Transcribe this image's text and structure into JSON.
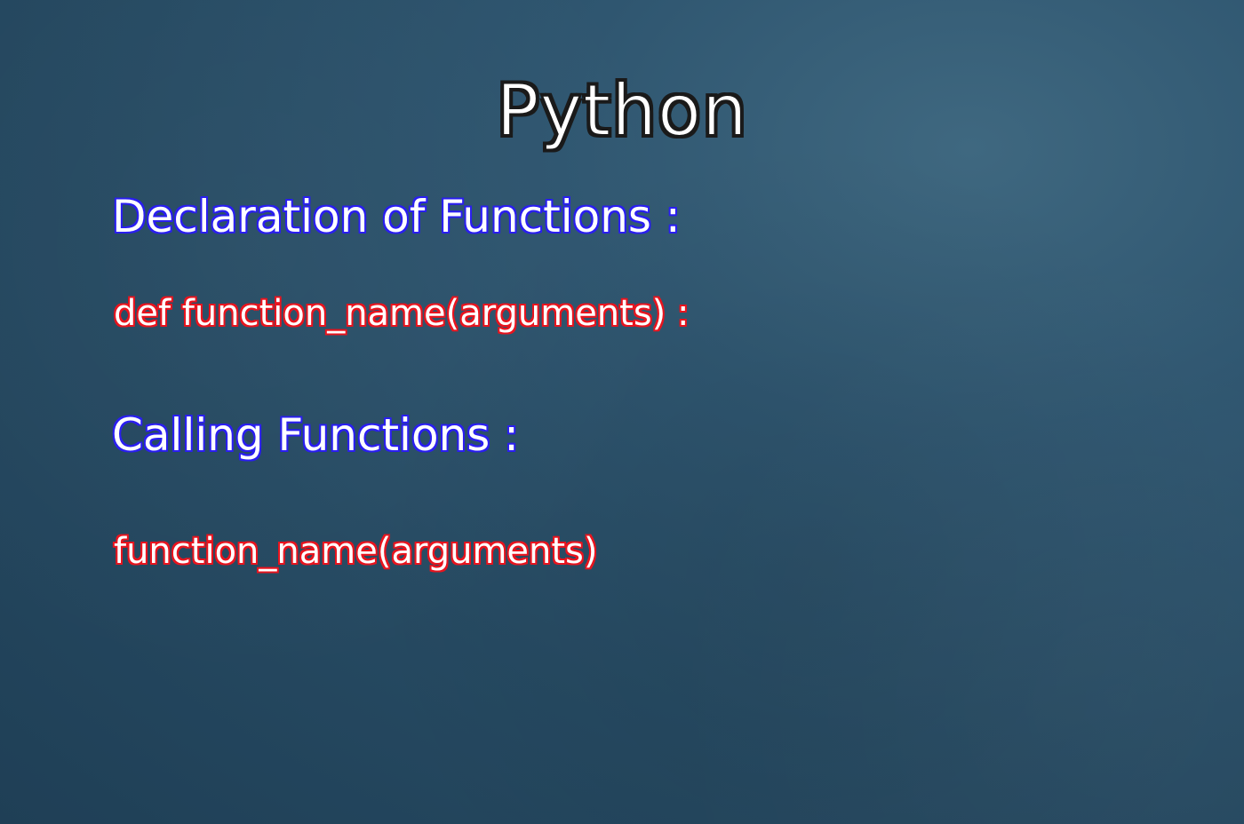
{
  "title": "Python",
  "sections": [
    {
      "heading": "Declaration of Functions :",
      "code": "def function_name(arguments) :"
    },
    {
      "heading": "Calling Functions :",
      "code": "function_name(arguments)"
    }
  ],
  "colors": {
    "background": "#2a4f67",
    "heading_outline": "#2a1ef0",
    "code_outline": "#e8141e",
    "text": "#ffffff"
  }
}
